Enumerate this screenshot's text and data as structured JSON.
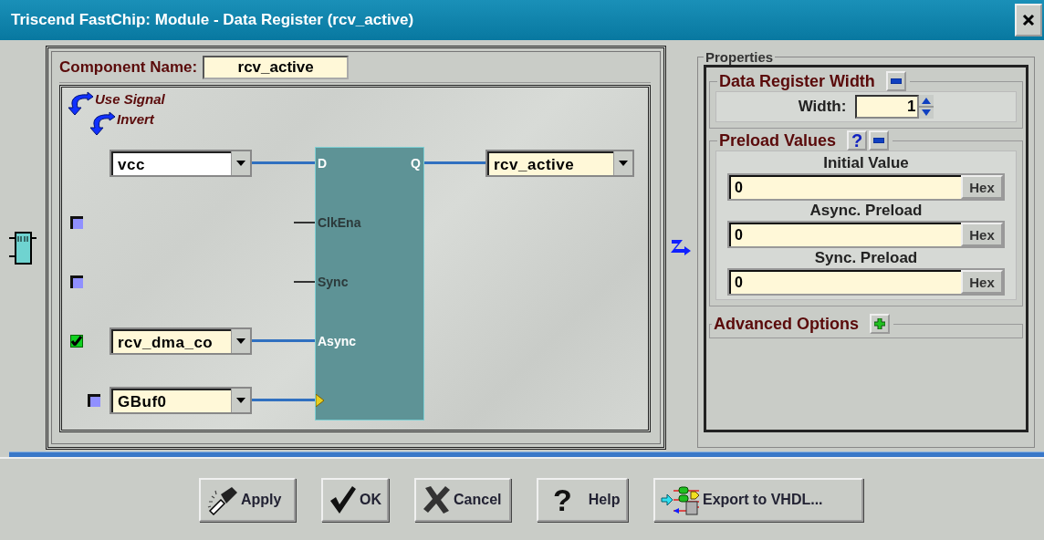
{
  "window": {
    "title": "Triscend FastChip: Module - Data Register (rcv_active)"
  },
  "component_name": {
    "label": "Component Name:",
    "value": "rcv_active"
  },
  "legend": [
    "Use Signal",
    "Invert"
  ],
  "block": {
    "output_pin": "Q",
    "output_signal": "rcv_active",
    "inputs": [
      {
        "kind": "data",
        "pin": "D",
        "signal": "vcc"
      },
      {
        "kind": "control",
        "pin": "ClkEna",
        "checked": false,
        "disabled": true
      },
      {
        "kind": "control",
        "pin": "Sync",
        "checked": false,
        "disabled": true
      },
      {
        "kind": "control",
        "pin": "Async",
        "checked": true,
        "disabled": false,
        "signal": "rcv_dma_co"
      },
      {
        "kind": "clock",
        "checked": false,
        "signal": "GBuf0"
      }
    ]
  },
  "properties": {
    "title": "Properties",
    "sections": [
      {
        "kind": "width",
        "title": "Data Register Width",
        "expanded": true,
        "label": "Width:",
        "value": "1"
      },
      {
        "kind": "preload",
        "title": "Preload Values",
        "expanded": true,
        "help": "?",
        "fields": [
          {
            "label": "Initial Value",
            "value": "0",
            "format": "Hex"
          },
          {
            "label": "Async. Preload",
            "value": "0",
            "format": "Hex"
          },
          {
            "label": "Sync. Preload",
            "value": "0",
            "format": "Hex"
          }
        ]
      },
      {
        "kind": "advanced",
        "title": "Advanced Options",
        "expanded": false
      }
    ]
  },
  "buttons": [
    {
      "kind": "apply",
      "label": "Apply"
    },
    {
      "kind": "ok",
      "label": "OK"
    },
    {
      "kind": "cancel",
      "label": "Cancel"
    },
    {
      "kind": "help",
      "label": "Help",
      "glyph": "?"
    },
    {
      "kind": "export",
      "label": "Export to VHDL..."
    }
  ]
}
